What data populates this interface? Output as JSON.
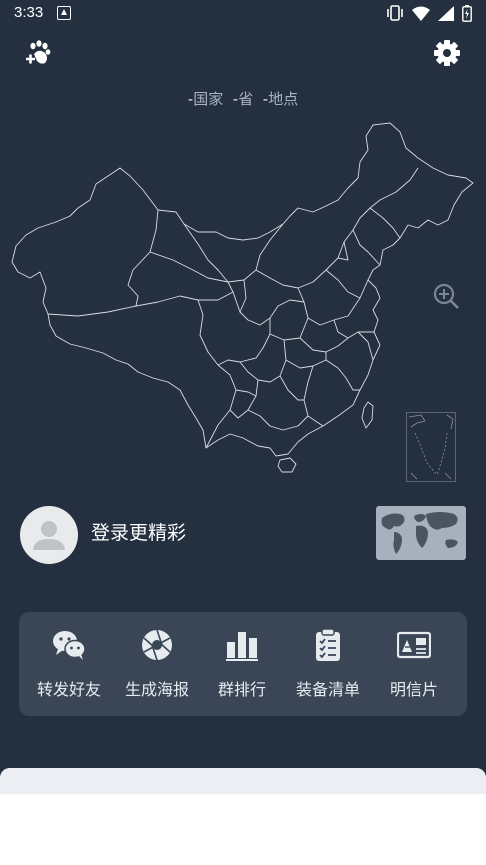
{
  "status_bar": {
    "time": "3:33"
  },
  "legend": {
    "dash1": "-",
    "country": "国家",
    "dash2": "-",
    "province": "省",
    "dash3": "-",
    "place": "地点"
  },
  "profile": {
    "login_text": "登录更精彩"
  },
  "toolbar": {
    "items": [
      {
        "label": "转发好友",
        "icon": "wechat-icon"
      },
      {
        "label": "生成海报",
        "icon": "aperture-icon"
      },
      {
        "label": "群排行",
        "icon": "bar-chart-icon"
      },
      {
        "label": "装备清单",
        "icon": "checklist-icon"
      },
      {
        "label": "明信片",
        "icon": "postcard-icon"
      }
    ]
  },
  "colors": {
    "background": "#24303f",
    "panel": "#3a4656",
    "map_outline": "#d8dde3",
    "text_muted": "#a9b4c2"
  }
}
